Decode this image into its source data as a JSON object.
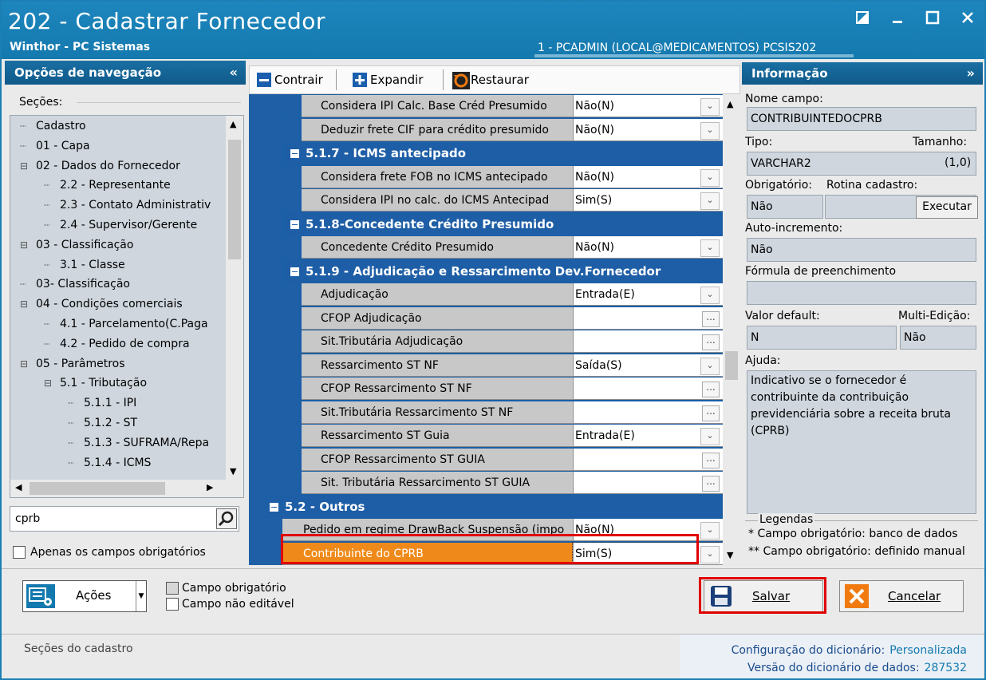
{
  "window": {
    "title": "202 - Cadastrar  Fornecedor",
    "subtitle": "Winthor - PC Sistemas",
    "session": "1 - PCADMIN (LOCAL@MEDICAMENTOS)   PCSIS202"
  },
  "nav": {
    "header": "Opções de navegação",
    "collapse_glyph": "«",
    "sections_label": "Seções:",
    "tree": [
      {
        "label": "Cadastro",
        "level": 0
      },
      {
        "label": "01 - Capa",
        "level": 0
      },
      {
        "label": "02 - Dados do Fornecedor",
        "level": 0
      },
      {
        "label": "2.2 - Representante",
        "level": 1
      },
      {
        "label": "2.3 - Contato Administrativ",
        "level": 1
      },
      {
        "label": "2.4 - Supervisor/Gerente",
        "level": 1
      },
      {
        "label": "03 - Classificação",
        "level": 0
      },
      {
        "label": "3.1 - Classe",
        "level": 1
      },
      {
        "label": "03- Classificação",
        "level": 0
      },
      {
        "label": "04 - Condições comerciais",
        "level": 0
      },
      {
        "label": "4.1 - Parcelamento(C.Paga",
        "level": 1
      },
      {
        "label": "4.2 - Pedido de compra",
        "level": 1
      },
      {
        "label": "05 - Parâmetros",
        "level": 0
      },
      {
        "label": "5.1 - Tributação",
        "level": 1
      },
      {
        "label": "5.1.1 - IPI",
        "level": 2
      },
      {
        "label": "5.1.2 - ST",
        "level": 2
      },
      {
        "label": "5.1.3 - SUFRAMA/Repa",
        "level": 2
      },
      {
        "label": "5.1.4 - ICMS",
        "level": 2
      }
    ],
    "search_value": "cprb",
    "only_required_label": "Apenas os campos obrigatórios"
  },
  "toolbar": {
    "collapse": "Contrair",
    "expand": "Expandir",
    "restore": "Restaurar"
  },
  "grid": {
    "rows": [
      {
        "type": "field",
        "label": "Considera IPI Calc. Base Créd Presumido",
        "value": "Não(N)",
        "editor": "dropdown",
        "indent": 2
      },
      {
        "type": "field",
        "label": "Deduzir frete CIF para crédito presumido",
        "value": "Não(N)",
        "editor": "dropdown",
        "indent": 2
      },
      {
        "type": "group",
        "label": "5.1.7 - ICMS antecipado",
        "indent": 1
      },
      {
        "type": "field",
        "label": "Considera frete FOB no ICMS antecipado",
        "value": "Não(N)",
        "editor": "dropdown",
        "indent": 2
      },
      {
        "type": "field",
        "label": "Considera IPI no calc. do ICMS Antecipad",
        "value": "Sim(S)",
        "editor": "dropdown",
        "indent": 2
      },
      {
        "type": "group",
        "label": "5.1.8-Concedente Crédito Presumido",
        "indent": 1
      },
      {
        "type": "field",
        "label": "Concedente Crédito Presumido",
        "value": "Não(N)",
        "editor": "dropdown",
        "indent": 2
      },
      {
        "type": "group",
        "label": "5.1.9 - Adjudicação e Ressarcimento Dev.Fornecedor",
        "indent": 1
      },
      {
        "type": "field",
        "label": "Adjudicação",
        "value": "Entrada(E)",
        "editor": "dropdown",
        "indent": 2
      },
      {
        "type": "field",
        "label": "CFOP Adjudicação",
        "value": "",
        "editor": "ellipsis",
        "indent": 2
      },
      {
        "type": "field",
        "label": "Sit.Tributária Adjudicação",
        "value": "",
        "editor": "ellipsis",
        "indent": 2
      },
      {
        "type": "field",
        "label": "Ressarcimento ST NF",
        "value": "Saída(S)",
        "editor": "dropdown",
        "indent": 2
      },
      {
        "type": "field",
        "label": "CFOP Ressarcimento ST NF",
        "value": "",
        "editor": "ellipsis",
        "indent": 2
      },
      {
        "type": "field",
        "label": "Sit.Tributária Ressarcimento ST NF",
        "value": "",
        "editor": "ellipsis",
        "indent": 2
      },
      {
        "type": "field",
        "label": "Ressarcimento ST Guia",
        "value": "Entrada(E)",
        "editor": "dropdown",
        "indent": 2
      },
      {
        "type": "field",
        "label": "CFOP Ressarcimento ST GUIA",
        "value": "",
        "editor": "ellipsis",
        "indent": 2
      },
      {
        "type": "field",
        "label": "Sit. Tributária Ressarcimento ST GUIA",
        "value": "",
        "editor": "ellipsis",
        "indent": 2
      },
      {
        "type": "group",
        "label": "5.2 - Outros",
        "indent": 0
      },
      {
        "type": "field",
        "label": "Pedido em regime DrawBack Suspensão (impo",
        "value": "Não(N)",
        "editor": "dropdown",
        "indent": 1
      },
      {
        "type": "field",
        "label": "Contribuinte do CPRB",
        "value": "Sim(S)",
        "editor": "dropdown",
        "indent": 1,
        "selected": true
      }
    ]
  },
  "info": {
    "header": "Informação",
    "expand_glyph": "»",
    "field_name_label": "Nome campo:",
    "field_name": "CONTRIBUINTEDOCPRB",
    "type_label": "Tipo:",
    "size_label": "Tamanho:",
    "type_value": "VARCHAR2",
    "size_value": "(1,0)",
    "required_label": "Obrigatório:",
    "routine_label": "Rotina cadastro:",
    "required_value": "Não",
    "routine_value": "",
    "execute_button": "Executar",
    "autoinc_label": "Auto-incremento:",
    "autoinc_value": "Não",
    "formula_label": "Fórmula de preenchimento",
    "formula_value": "",
    "default_label": "Valor default:",
    "multi_label": "Multi-Edição:",
    "default_value": "N",
    "multi_value": "Não",
    "help_label": "Ajuda:",
    "help_text": "Indicativo se o fornecedor é contribuinte da contribuição previdenciária sobre a receita bruta (CPRB)",
    "legend_title": "Legendas",
    "legend_line1": "* Campo obrigatório: banco de dados",
    "legend_line2": "** Campo obrigatório: definido manual"
  },
  "bottom": {
    "actions_button": "Ações",
    "legend_required": "Campo obrigatório",
    "legend_not_editable": "Campo não editável",
    "save_button": "Salvar",
    "cancel_button": "Cancelar"
  },
  "status": {
    "left": "Seções do cadastro",
    "dict_config_label": "Configuração do dicionário:",
    "dict_config_value": "Personalizada",
    "dict_version_label": "Versão do dicionário de dados:",
    "dict_version_value": "287532"
  },
  "colors": {
    "title_bar": "#1479ae",
    "group_header": "#1e5ea6",
    "selected_row": "#ef8a1a",
    "highlight_box": "#e00000"
  }
}
